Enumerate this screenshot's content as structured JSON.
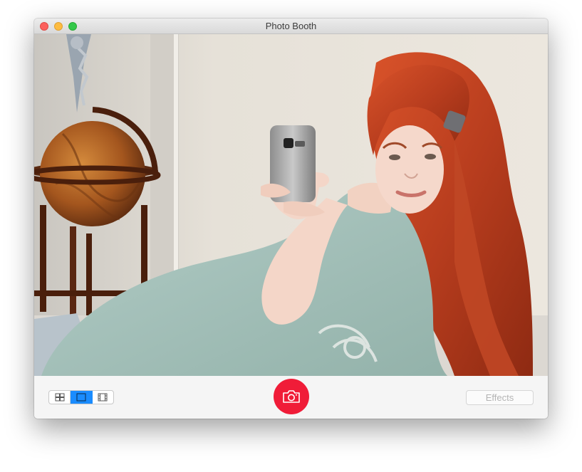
{
  "window": {
    "title": "Photo Booth"
  },
  "viewer": {
    "content": "camera-preview"
  },
  "toolbar": {
    "view_modes": [
      {
        "name": "four-up",
        "icon": "grid-4-icon",
        "selected": false
      },
      {
        "name": "single",
        "icon": "single-frame-icon",
        "selected": true
      },
      {
        "name": "video",
        "icon": "film-strip-icon",
        "selected": false
      }
    ],
    "shutter_icon": "camera-icon",
    "effects_label": "Effects"
  },
  "colors": {
    "shutter": "#f01c38",
    "selected_segment": "#1a8cff",
    "effects_text_disabled": "#b4b4b4"
  }
}
